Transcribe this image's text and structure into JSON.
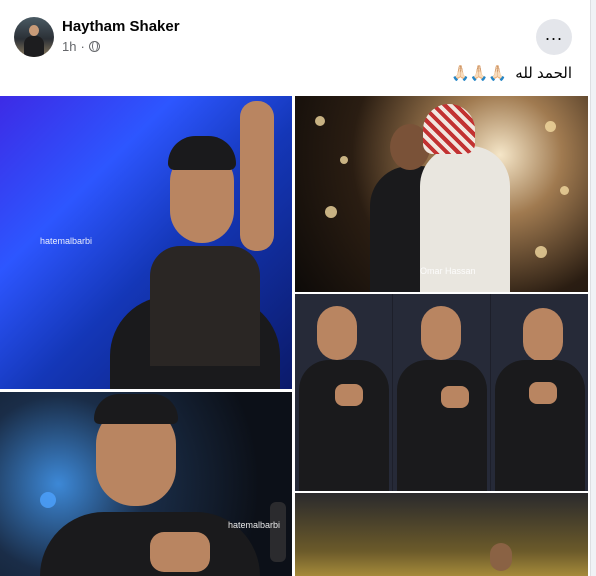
{
  "post": {
    "author": "Haytham Shaker",
    "time": "1h",
    "separator": "·",
    "privacy_icon": "globe-icon",
    "more_icon": "ellipsis-icon",
    "more_label": "...",
    "caption_text": "الحمد لله",
    "caption_emoji": "🙏🏻🙏🏻🙏🏻"
  },
  "photos": {
    "p1_watermark": "hatemalbarbi",
    "p2_watermark": "Omar Hassan",
    "p4_watermark": "hatemalbarbi"
  }
}
